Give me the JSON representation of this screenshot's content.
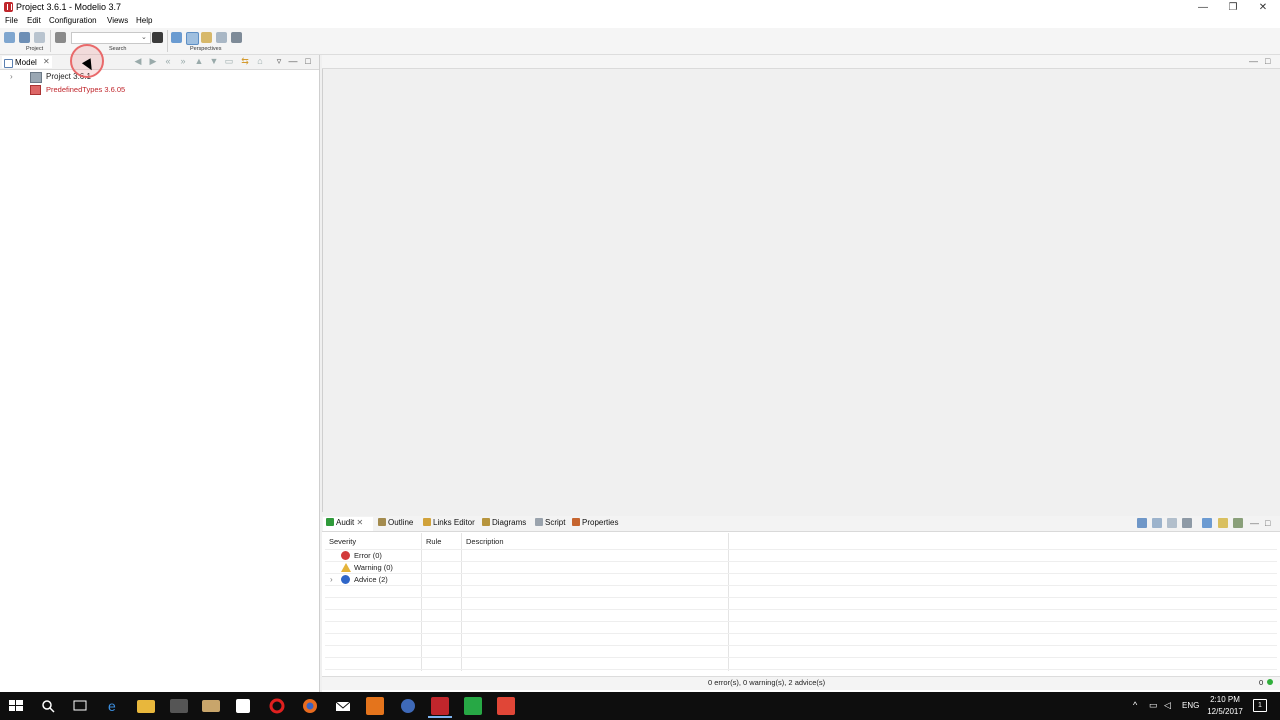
{
  "window": {
    "title": "Project 3.6.1 - Modelio 3.7",
    "controls": {
      "minimize": "—",
      "restore": "❐",
      "close": "✕"
    }
  },
  "menu": {
    "items": [
      "File",
      "Edit",
      "Configuration",
      "Views",
      "Help"
    ]
  },
  "toolbar": {
    "groups": {
      "project_label": "Project",
      "search_label": "Search",
      "perspectives_label": "Perspectives"
    },
    "search_value": ""
  },
  "model_panel": {
    "tab_label": "Model",
    "tree": [
      {
        "label": "Project 3.6.1",
        "expandable": true
      },
      {
        "label": "PredefinedTypes 3.6.05",
        "expandable": false
      }
    ]
  },
  "bottom_panel": {
    "tabs": [
      "Audit",
      "Outline",
      "Links Editor",
      "Diagrams",
      "Script",
      "Properties"
    ],
    "audit": {
      "columns": [
        "Severity",
        "Rule",
        "Description"
      ],
      "rows": [
        {
          "label": "Error (0)",
          "icon": "error-icon"
        },
        {
          "label": "Warning (0)",
          "icon": "warning-icon"
        },
        {
          "label": "Advice (2)",
          "icon": "info-icon"
        }
      ]
    },
    "status_text": "0 error(s), 0 warning(s), 2 advice(s)",
    "status_count": "0"
  },
  "taskbar": {
    "language": "ENG",
    "time": "2:10 PM",
    "date": "12/5/2017",
    "notification_count": "1"
  },
  "colors": {
    "accent_red": "#c0262c",
    "status_green": "#2fae3a",
    "taskbar": "#0e0e0e"
  }
}
